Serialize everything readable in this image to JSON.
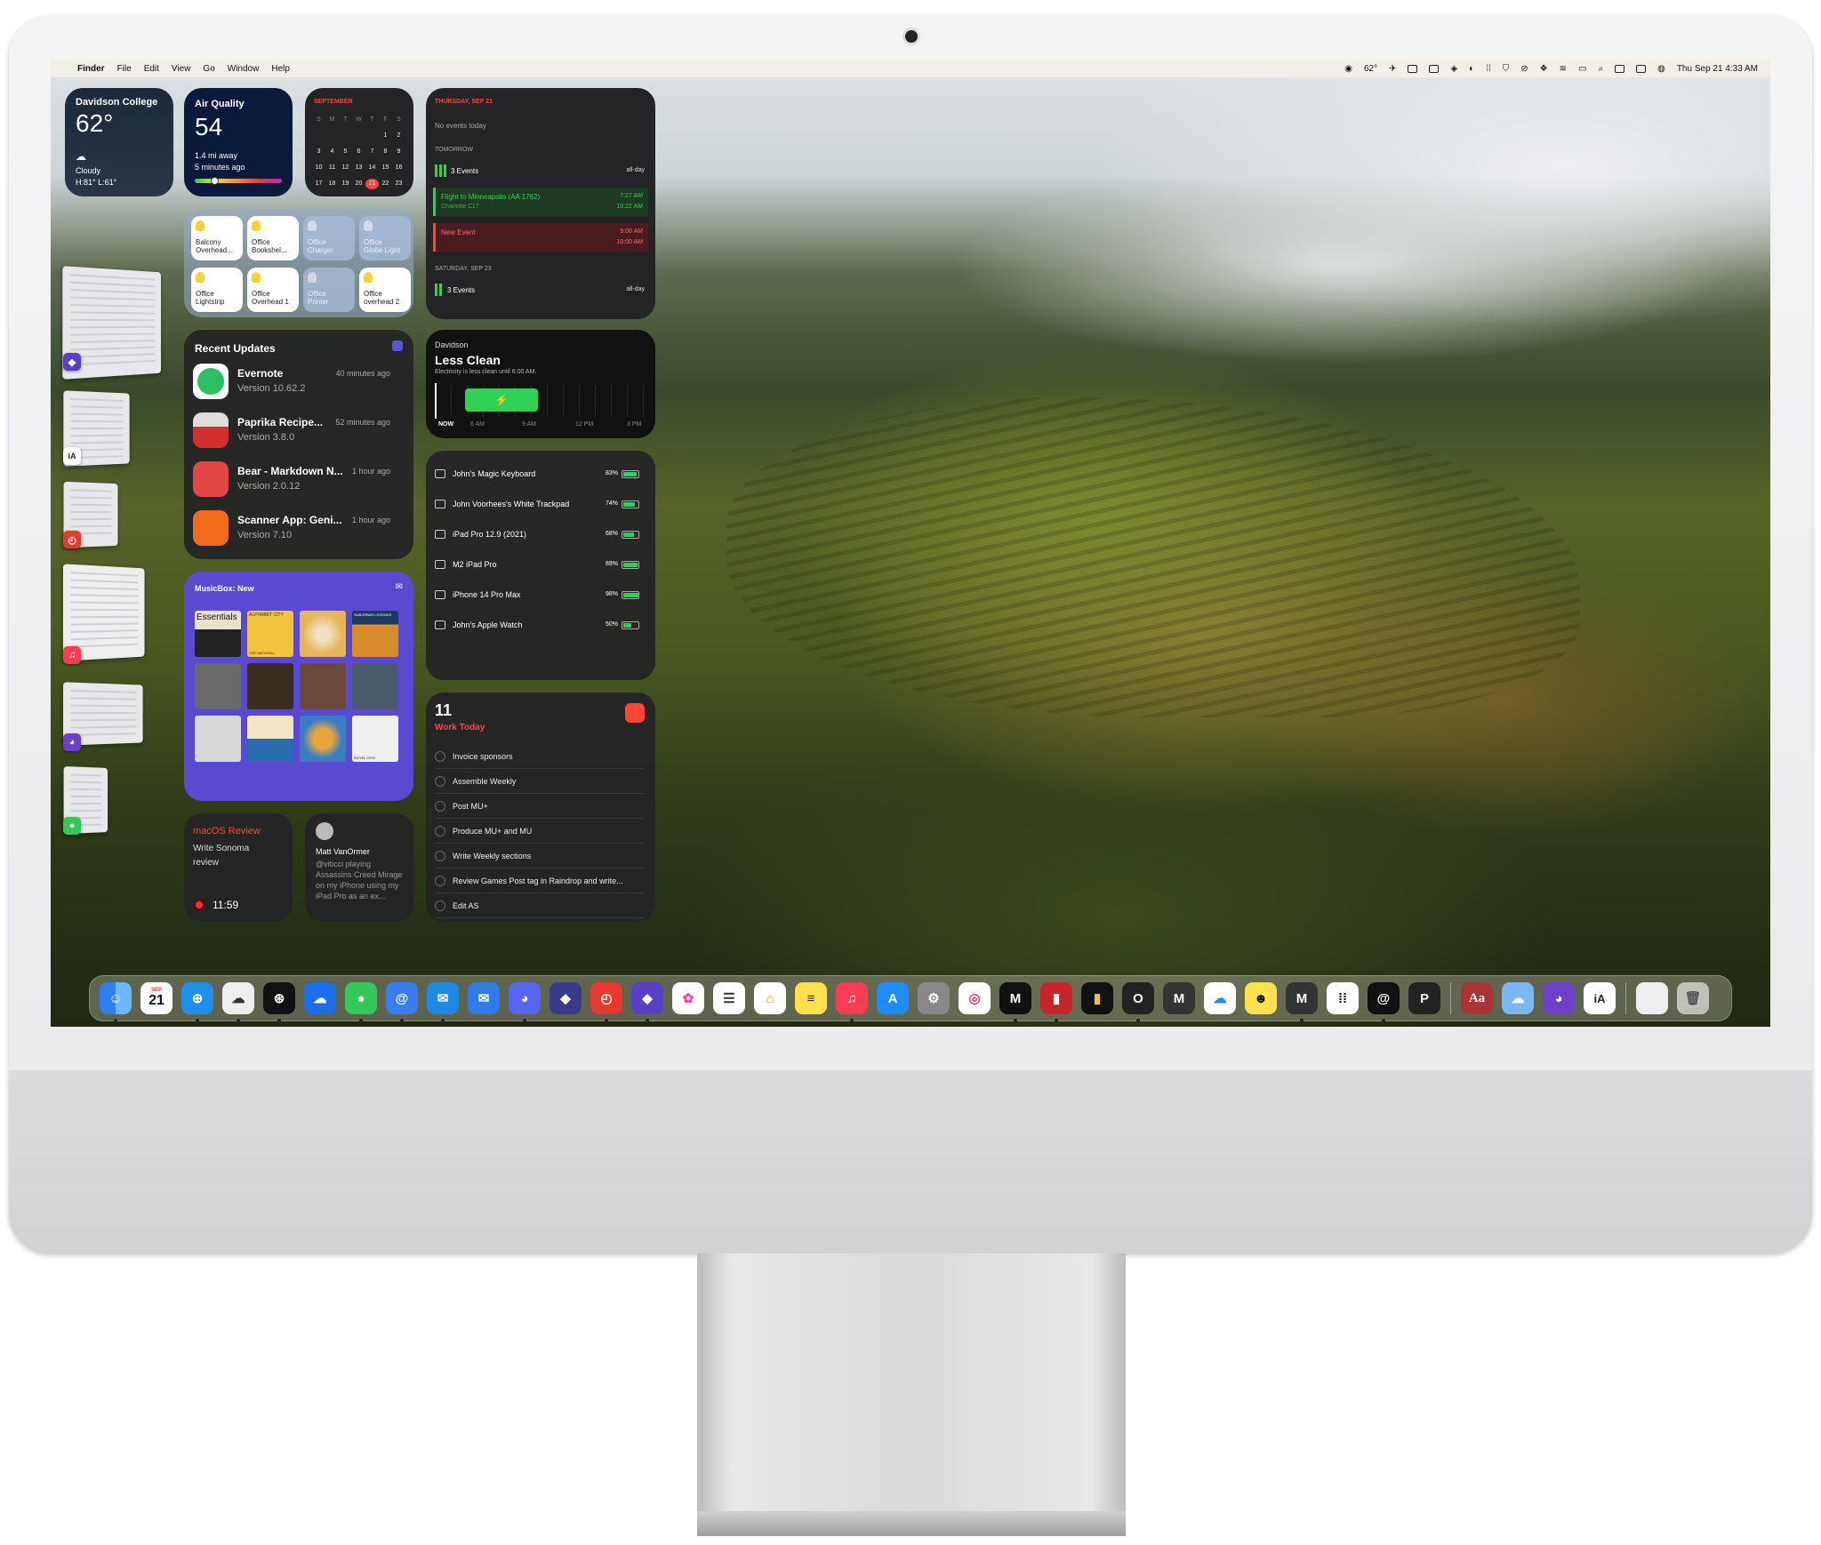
{
  "menubar": {
    "apple": "",
    "app": "Finder",
    "menus": [
      "File",
      "Edit",
      "View",
      "Go",
      "Window",
      "Help"
    ],
    "weather": "62°",
    "clock": "Thu Sep 21  4:33 AM"
  },
  "weather_widget": {
    "location": "Davidson College",
    "temp": "62°",
    "condition": "Cloudy",
    "hilo": "H:81° L:61°"
  },
  "air_quality": {
    "title": "Air Quality",
    "value": "54",
    "distance": "1.4 mi away",
    "updated": "5 minutes ago",
    "level_fraction": 0.22
  },
  "calendar_month": {
    "month": "SEPTEMBER",
    "weekdays": [
      "S",
      "M",
      "T",
      "W",
      "T",
      "F",
      "S"
    ],
    "rows": [
      [
        "",
        "",
        "",
        "",
        "",
        "1",
        "2"
      ],
      [
        "3",
        "4",
        "5",
        "6",
        "7",
        "8",
        "9"
      ],
      [
        "10",
        "11",
        "12",
        "13",
        "14",
        "15",
        "16"
      ],
      [
        "17",
        "18",
        "19",
        "20",
        "21",
        "22",
        "23"
      ],
      [
        "24",
        "25",
        "26",
        "27",
        "28",
        "29",
        "30"
      ]
    ],
    "today": "21"
  },
  "home": {
    "tiles": [
      {
        "line1": "Balcony",
        "line2": "Overhead...",
        "on": true
      },
      {
        "line1": "Office",
        "line2": "Bookshel...",
        "on": true
      },
      {
        "line1": "Office",
        "line2": "Charger",
        "on": false
      },
      {
        "line1": "Office",
        "line2": "Globe Light",
        "on": false
      },
      {
        "line1": "Office",
        "line2": "Lightstrip",
        "on": true
      },
      {
        "line1": "Office",
        "line2": "Overhead 1",
        "on": true
      },
      {
        "line1": "Office",
        "line2": "Printer",
        "on": false
      },
      {
        "line1": "Office",
        "line2": "overhead 2",
        "on": true
      }
    ]
  },
  "updates": {
    "title": "Recent Updates",
    "items": [
      {
        "name": "Evernote",
        "version": "Version 10.62.2",
        "time": "40 minutes ago",
        "color": "#2dbe60"
      },
      {
        "name": "Paprika Recipe...",
        "version": "Version 3.8.0",
        "time": "52 minutes ago",
        "color": "#d32f2f"
      },
      {
        "name": "Bear - Markdown N...",
        "version": "Version 2.0.12",
        "time": "1 hour ago",
        "color": "#e04848"
      },
      {
        "name": "Scanner App: Geni...",
        "version": "Version 7.10",
        "time": "1 hour ago",
        "color": "#f26b1d"
      }
    ]
  },
  "music": {
    "title": "MusicBox: New",
    "labels": [
      "Essentials",
      "ALPHABET CITY",
      "THE NATIONAL",
      "SUBURBAN LEGENDS",
      "ROYEL OTIS"
    ]
  },
  "note_widget": {
    "title": "macOS Review",
    "body": "Write Sonoma review",
    "time": "11:59"
  },
  "social_widget": {
    "name": "Matt VanOrmer",
    "text": "@viticci playing Assassins Creed Mirage on my iPhone using my iPad Pro as an ex..."
  },
  "agenda": {
    "day1": "THURSDAY, SEP 21",
    "none": "No events today",
    "tomorrow": "TOMORROW",
    "events_label": "3 Events",
    "allday": "all-day",
    "e1_title": "Flight to Minneapolis (AA 1762)",
    "e1_sub": "Charlotte CLT",
    "e1_start": "7:27 AM",
    "e1_end": "10:22 AM",
    "e2_title": "New Event",
    "e2_start": "9:00 AM",
    "e2_end": "10:00 AM",
    "day3": "SATURDAY, SEP 23",
    "events_label2": "3 Events",
    "allday2": "all-day"
  },
  "grid": {
    "location": "Davidson",
    "status": "Less Clean",
    "note": "Electricity is less clean until 6:00 AM.",
    "now": "NOW",
    "ticks": [
      "6 AM",
      "9 AM",
      "12 PM",
      "3 PM"
    ]
  },
  "batteries": {
    "devices": [
      {
        "name": "John's Magic Keyboard",
        "pct": "83%",
        "level": 0.83
      },
      {
        "name": "John Voorhees's White Trackpad",
        "pct": "74%",
        "level": 0.74
      },
      {
        "name": "iPad Pro 12.9 (2021)",
        "pct": "68%",
        "level": 0.68
      },
      {
        "name": "M2 iPad Pro",
        "pct": "89%",
        "level": 0.89
      },
      {
        "name": "iPhone 14 Pro Max",
        "pct": "98%",
        "level": 0.98
      },
      {
        "name": "John's Apple Watch",
        "pct": "50%",
        "level": 0.5
      }
    ]
  },
  "reminders": {
    "count": "11",
    "list": "Work Today",
    "items": [
      "Invoice sponsors",
      "Assemble Weekly",
      "Post MU+",
      "Produce MU+ and MU",
      "Write Weekly sections",
      "Review Games Post tag in Raindrop and write...",
      "Edit AS"
    ]
  },
  "dock": {
    "calendar_month": "SEP",
    "calendar_day": "21",
    "letter_icons": [
      "O",
      "M",
      "M",
      "P",
      "Aa",
      "iA"
    ]
  }
}
